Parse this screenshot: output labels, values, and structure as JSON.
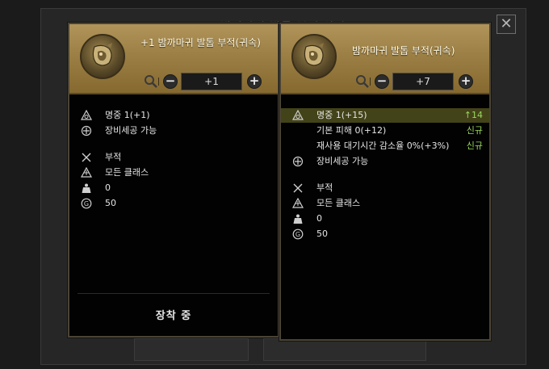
{
  "background_window": {
    "title": "밤까마귀 발톱 부적 상자"
  },
  "close_label": "✕",
  "left_panel": {
    "item_name": "+1 밤까마귀 발톱 부적(귀속)",
    "level_value": "+1",
    "stats": [
      {
        "icon": "accuracy-icon",
        "text": "명중 1(+1)"
      },
      {
        "icon": "craft-icon",
        "text": "장비세공 가능"
      }
    ],
    "info": [
      {
        "icon": "swords-icon",
        "text": "부적"
      },
      {
        "icon": "class-icon",
        "text": "모든 클래스"
      },
      {
        "icon": "weight-icon",
        "text": "0"
      },
      {
        "icon": "gold-icon",
        "text": "50"
      }
    ],
    "equipped_label": "장착 중"
  },
  "right_panel": {
    "item_name": "밤까마귀 발톱 부적(귀속)",
    "level_value": "+7",
    "stats": [
      {
        "icon": "accuracy-icon",
        "text": "명중 1(+15)",
        "delta": "↑14",
        "highlight": true
      },
      {
        "icon": "",
        "text": "기본 피해 0(+12)",
        "delta": "신규"
      },
      {
        "icon": "",
        "text": "재사용 대기시간 감소율 0%(+3%)",
        "delta": "신규"
      },
      {
        "icon": "craft-icon",
        "text": "장비세공 가능"
      }
    ],
    "info": [
      {
        "icon": "swords-icon",
        "text": "부적"
      },
      {
        "icon": "class-icon",
        "text": "모든 클래스"
      },
      {
        "icon": "weight-icon",
        "text": "0"
      },
      {
        "icon": "gold-icon",
        "text": "50"
      }
    ]
  },
  "colors": {
    "header_gold": "#9b7f44",
    "highlight_row": "#434319",
    "delta_green": "#9ad65e"
  }
}
